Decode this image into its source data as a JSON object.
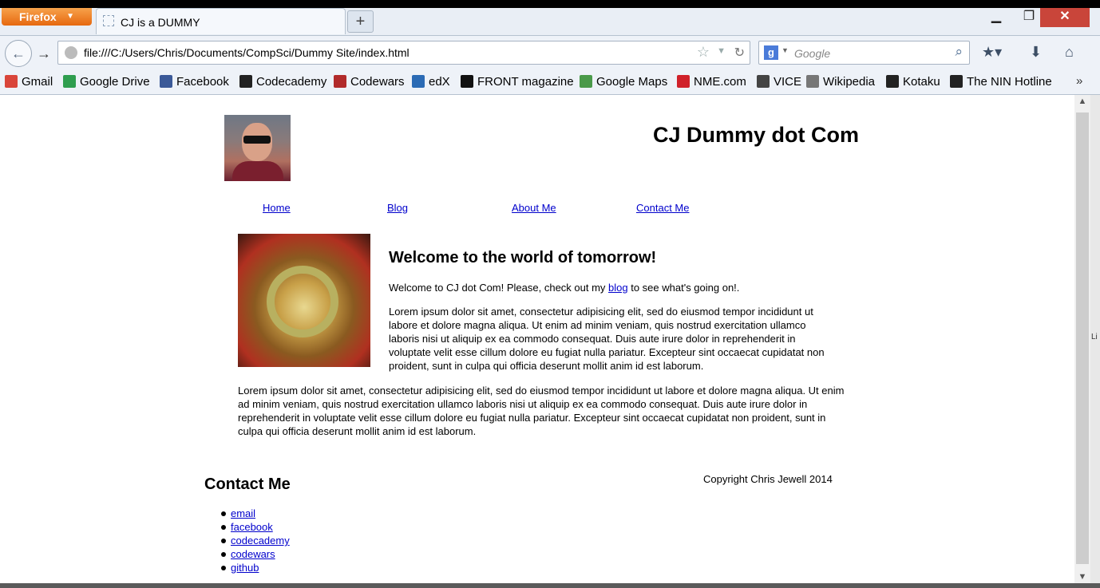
{
  "browser": {
    "app_button": "Firefox",
    "tab_title": "CJ is a DUMMY",
    "new_tab": "+",
    "url": "file:///C:/Users/Chris/Documents/CompSci/Dummy Site/index.html",
    "search_placeholder": "Google",
    "bookmarks": [
      "Gmail",
      "Google Drive",
      "Facebook",
      "Codecademy",
      "Codewars",
      "edX",
      "FRONT magazine",
      "Google Maps",
      "NME.com",
      "VICE",
      "Wikipedia",
      "Kotaku",
      "The NIN Hotline"
    ],
    "bookmark_colors": [
      "#d9453a",
      "#2f9e4f",
      "#3b5998",
      "#222222",
      "#b12a2a",
      "#2b6bb5",
      "#111111",
      "#4a9a4a",
      "#d0212a",
      "#444444",
      "#777777",
      "#222222",
      "#222222"
    ],
    "bookmarks_more": "»"
  },
  "page": {
    "site_title": "CJ Dummy dot Com",
    "nav": [
      "Home",
      "Blog",
      "About Me",
      "Contact Me"
    ],
    "welcome_heading": "Welcome to the world of tomorrow!",
    "welcome_pre": "Welcome to CJ dot Com! Please, check out my ",
    "welcome_link": "blog",
    "welcome_post": " to see what's going on!.",
    "para1": "Lorem ipsum dolor sit amet, consectetur adipisicing elit, sed do eiusmod tempor incididunt ut labore et dolore magna aliqua. Ut enim ad minim veniam, quis nostrud exercitation ullamco laboris nisi ut aliquip ex ea commodo consequat. Duis aute irure dolor in reprehenderit in voluptate velit esse cillum dolore eu fugiat nulla pariatur. Excepteur sint occaecat cupidatat non proident, sunt in culpa qui officia deserunt mollit anim id est laborum.",
    "para2": "Lorem ipsum dolor sit amet, consectetur adipisicing elit, sed do eiusmod tempor incididunt ut labore et dolore magna aliqua. Ut enim ad minim veniam, quis nostrud exercitation ullamco laboris nisi ut aliquip ex ea commodo consequat. Duis aute irure dolor in reprehenderit in voluptate velit esse cillum dolore eu fugiat nulla pariatur. Excepteur sint occaecat cupidatat non proident, sunt in culpa qui officia deserunt mollit anim id est laborum.",
    "contact_heading": "Contact Me",
    "contact_links": [
      "email",
      "facebook",
      "codecademy",
      "codewars",
      "github"
    ],
    "copyright": "Copyright Chris Jewell 2014"
  },
  "edge_text": "Li"
}
